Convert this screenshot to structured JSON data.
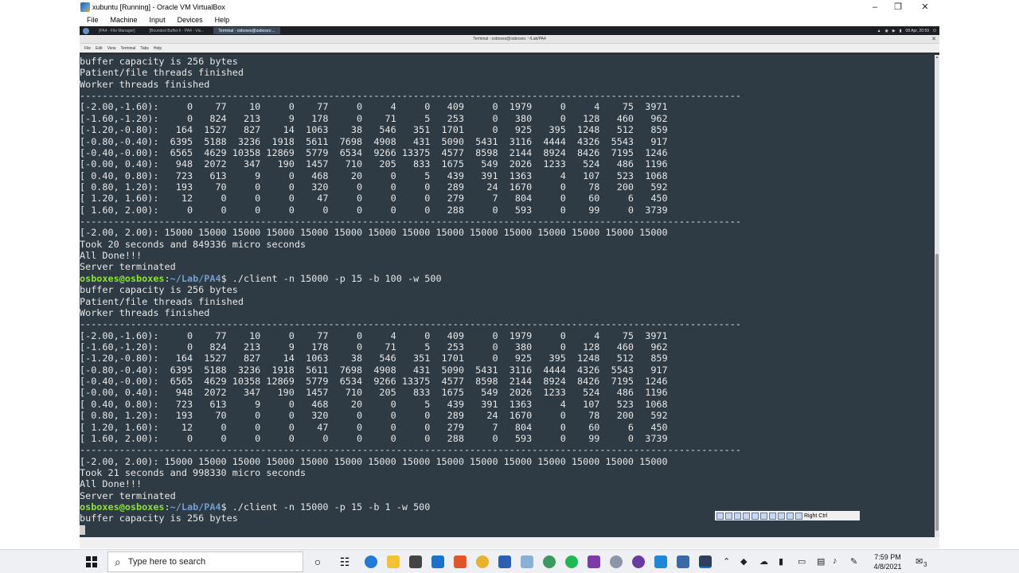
{
  "vbox": {
    "title": "xubuntu [Running] - Oracle VM VirtualBox",
    "menu": [
      "File",
      "Machine",
      "Input",
      "Devices",
      "Help"
    ]
  },
  "xfce_panel": {
    "tasks": [
      "[PA4 - File Manager]",
      "[Bounded Buffer.h - PA4 - Vis...",
      "Terminal - osboxes@osboxes:..."
    ],
    "clock": "08 Apr, 20:59"
  },
  "terminal": {
    "title": "Terminal - osboxes@osboxes: ~/Lab/PA4",
    "menu": [
      "File",
      "Edit",
      "View",
      "Terminal",
      "Tabs",
      "Help"
    ],
    "lines": [
      {
        "text": "buffer capacity is 256 bytes"
      },
      {
        "text": "Patient/file threads finished"
      },
      {
        "text": "Worker threads finished"
      },
      {
        "text": "---------------------------------------------------------------------------------------------------------------------"
      },
      {
        "text": "[-2.00,-1.60):     0    77    10     0    77     0     4     0   409     0  1979     0     4    75  3971"
      },
      {
        "text": "[-1.60,-1.20):     0   824   213     9   178     0    71     5   253     0   380     0   128   460   962"
      },
      {
        "text": "[-1.20,-0.80):   164  1527   827    14  1063    38   546   351  1701     0   925   395  1248   512   859"
      },
      {
        "text": "[-0.80,-0.40):  6395  5188  3236  1918  5611  7698  4908   431  5090  5431  3116  4444  4326  5543   917"
      },
      {
        "text": "[-0.40,-0.00):  6565  4629 10358 12869  5779  6534  9266 13375  4577  8598  2144  8924  8426  7195  1246"
      },
      {
        "text": "[-0.00, 0.40):   948  2072   347   190  1457   710   205   833  1675   549  2026  1233   524   486  1196"
      },
      {
        "text": "[ 0.40, 0.80):   723   613     9     0   468    20     0     5   439   391  1363     4   107   523  1068"
      },
      {
        "text": "[ 0.80, 1.20):   193    70     0     0   320     0     0     0   289    24  1670     0    78   200   592"
      },
      {
        "text": "[ 1.20, 1.60):    12     0     0     0    47     0     0     0   279     7   804     0    60     6   450"
      },
      {
        "text": "[ 1.60, 2.00):     0     0     0     0     0     0     0     0   288     0   593     0    99     0  3739"
      },
      {
        "text": "---------------------------------------------------------------------------------------------------------------------"
      },
      {
        "text": "[-2.00, 2.00): 15000 15000 15000 15000 15000 15000 15000 15000 15000 15000 15000 15000 15000 15000 15000"
      },
      {
        "text": "Took 20 seconds and 849336 micro seconds"
      },
      {
        "text": "All Done!!!"
      },
      {
        "text": "Server terminated"
      },
      {
        "user": "osboxes@osboxes",
        "path": "~/Lab/PA4",
        "symbol": "$ ",
        "cmd": "./client -n 15000 -p 15 -b 100 -w 500"
      },
      {
        "text": "buffer capacity is 256 bytes"
      },
      {
        "text": "Patient/file threads finished"
      },
      {
        "text": "Worker threads finished"
      },
      {
        "text": "---------------------------------------------------------------------------------------------------------------------"
      },
      {
        "text": "[-2.00,-1.60):     0    77    10     0    77     0     4     0   409     0  1979     0     4    75  3971"
      },
      {
        "text": "[-1.60,-1.20):     0   824   213     9   178     0    71     5   253     0   380     0   128   460   962"
      },
      {
        "text": "[-1.20,-0.80):   164  1527   827    14  1063    38   546   351  1701     0   925   395  1248   512   859"
      },
      {
        "text": "[-0.80,-0.40):  6395  5188  3236  1918  5611  7698  4908   431  5090  5431  3116  4444  4326  5543   917"
      },
      {
        "text": "[-0.40,-0.00):  6565  4629 10358 12869  5779  6534  9266 13375  4577  8598  2144  8924  8426  7195  1246"
      },
      {
        "text": "[-0.00, 0.40):   948  2072   347   190  1457   710   205   833  1675   549  2026  1233   524   486  1196"
      },
      {
        "text": "[ 0.40, 0.80):   723   613     9     0   468    20     0     5   439   391  1363     4   107   523  1068"
      },
      {
        "text": "[ 0.80, 1.20):   193    70     0     0   320     0     0     0   289    24  1670     0    78   200   592"
      },
      {
        "text": "[ 1.20, 1.60):    12     0     0     0    47     0     0     0   279     7   804     0    60     6   450"
      },
      {
        "text": "[ 1.60, 2.00):     0     0     0     0     0     0     0     0   288     0   593     0    99     0  3739"
      },
      {
        "text": "---------------------------------------------------------------------------------------------------------------------"
      },
      {
        "text": "[-2.00, 2.00): 15000 15000 15000 15000 15000 15000 15000 15000 15000 15000 15000 15000 15000 15000 15000"
      },
      {
        "text": "Took 21 seconds and 998330 micro seconds"
      },
      {
        "text": "All Done!!!"
      },
      {
        "text": "Server terminated"
      },
      {
        "user": "osboxes@osboxes",
        "path": "~/Lab/PA4",
        "symbol": "$ ",
        "cmd": "./client -n 15000 -p 15 -b 1 -w 500"
      },
      {
        "text": "buffer capacity is 256 bytes"
      }
    ]
  },
  "guest_tray": {
    "label": "Right Ctrl"
  },
  "taskbar": {
    "search_placeholder": "Type here to search",
    "time": "7:59 PM",
    "date": "4/8/2021",
    "notification_count": "3"
  },
  "colors": {
    "terminal_bg": "#2f3b44",
    "terminal_fg": "#e6e6e6",
    "prompt_user": "#8ae234",
    "prompt_path": "#729fcf"
  }
}
